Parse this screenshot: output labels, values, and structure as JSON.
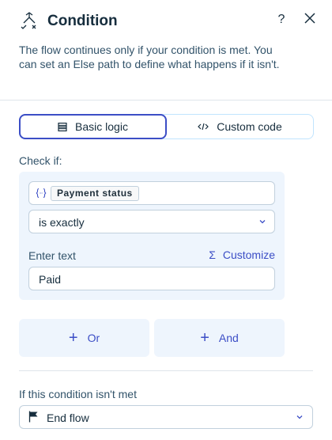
{
  "header": {
    "title": "Condition",
    "help_glyph": "?",
    "icons": [
      "condition-branch-icon",
      "help-icon",
      "close-icon"
    ]
  },
  "description": "The flow continues only if your condition is met. You can set an Else path to define what happens if it isn't.",
  "mode_toggle": {
    "selected": "Basic logic",
    "options": [
      {
        "label": "Basic logic",
        "icon": "list-icon"
      },
      {
        "label": "Custom code",
        "icon": "code-icon"
      }
    ]
  },
  "condition": {
    "check_label": "Check if:",
    "variable": {
      "icon": "variable-icon",
      "chip": "Payment status"
    },
    "operator": "is exactly",
    "value_label": "Enter text",
    "customize": {
      "glyph": "Σ",
      "label": "Customize"
    },
    "value": "Paid"
  },
  "logic_buttons": {
    "or_label": "Or",
    "and_label": "And",
    "plus_glyph": "+"
  },
  "else_path": {
    "label": "If this condition isn't met",
    "selected": "End flow",
    "icon": "flag-icon"
  },
  "colors": {
    "accent": "#3c4ec6",
    "panel_bg": "#eef5fd",
    "text": "#162d3d",
    "secondary_text": "#32536a",
    "border": "#c1d0dd"
  }
}
